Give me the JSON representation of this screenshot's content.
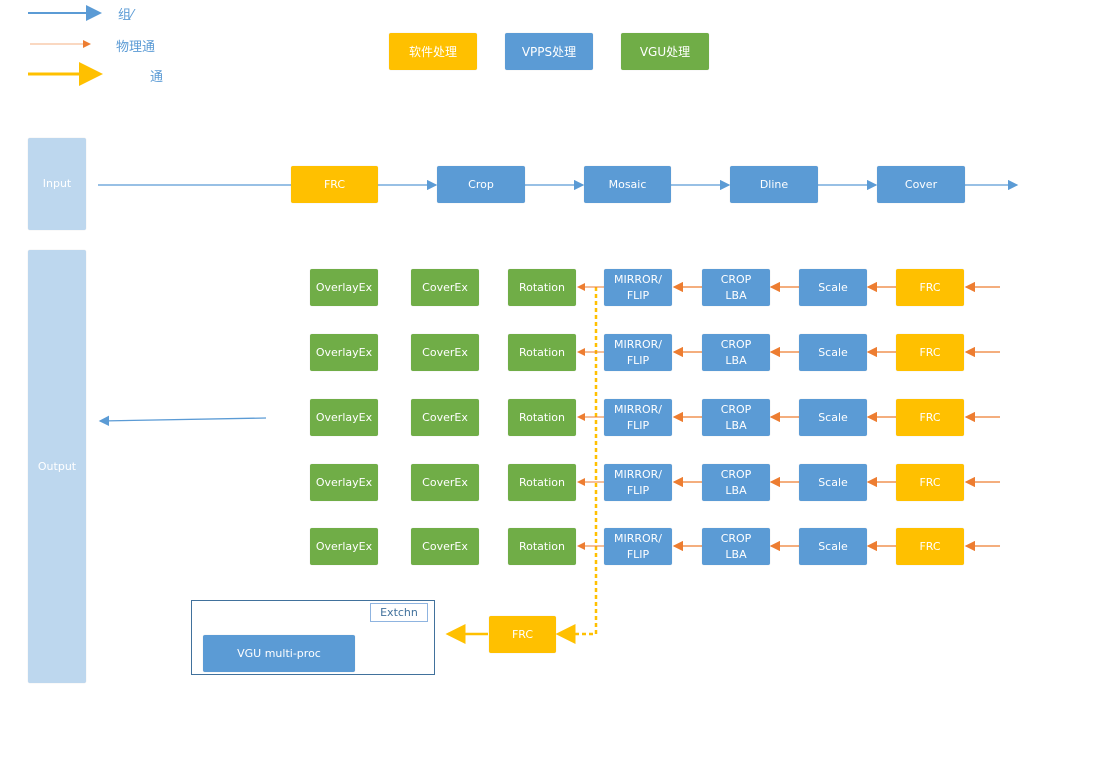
{
  "legend": {
    "items": [
      {
        "label": "组⁄",
        "line": "blue-solid-arrow",
        "color": "#5b9bd5"
      },
      {
        "label": "物理通",
        "line": "orange-thin-arrow",
        "color": "#ed7d31"
      },
      {
        "label": "通",
        "line": "yellow-solid-arrow",
        "color": "#ffc000"
      }
    ],
    "categories": [
      {
        "label": "软件处理",
        "color": "#ffc000"
      },
      {
        "label": "VPPS处理",
        "color": "#5b9bd5"
      },
      {
        "label": "VGU处理",
        "color": "#70ad47"
      }
    ]
  },
  "input": {
    "label": "Input",
    "pipeline": [
      {
        "label": "FRC",
        "type": "software"
      },
      {
        "label": "Crop",
        "type": "vpps"
      },
      {
        "label": "Mosaic",
        "type": "vpps"
      },
      {
        "label": "Dline",
        "type": "vpps"
      },
      {
        "label": "Cover",
        "type": "vpps"
      }
    ]
  },
  "output": {
    "label": "Output",
    "channels": [
      [
        "OverlayEx",
        "CoverEx",
        "Rotation",
        "MIRROR/\nFLIP",
        "CROP\nLBA",
        "Scale",
        "FRC"
      ],
      [
        "OverlayEx",
        "CoverEx",
        "Rotation",
        "MIRROR/\nFLIP",
        "CROP\nLBA",
        "Scale",
        "FRC"
      ],
      [
        "OverlayEx",
        "CoverEx",
        "Rotation",
        "MIRROR/\nFLIP",
        "CROP\nLBA",
        "Scale",
        "FRC"
      ],
      [
        "OverlayEx",
        "CoverEx",
        "Rotation",
        "MIRROR/\nFLIP",
        "CROP\nLBA",
        "Scale",
        "FRC"
      ],
      [
        "OverlayEx",
        "CoverEx",
        "Rotation",
        "MIRROR/\nFLIP",
        "CROP\nLBA",
        "Scale",
        "FRC"
      ]
    ],
    "channel_types": [
      "vgu",
      "vgu",
      "vgu",
      "vpps",
      "vpps",
      "vpps",
      "software"
    ]
  },
  "extchn": {
    "tag": "Extchn",
    "frc_label": "FRC",
    "vgu_label": "VGU multi-proc"
  }
}
